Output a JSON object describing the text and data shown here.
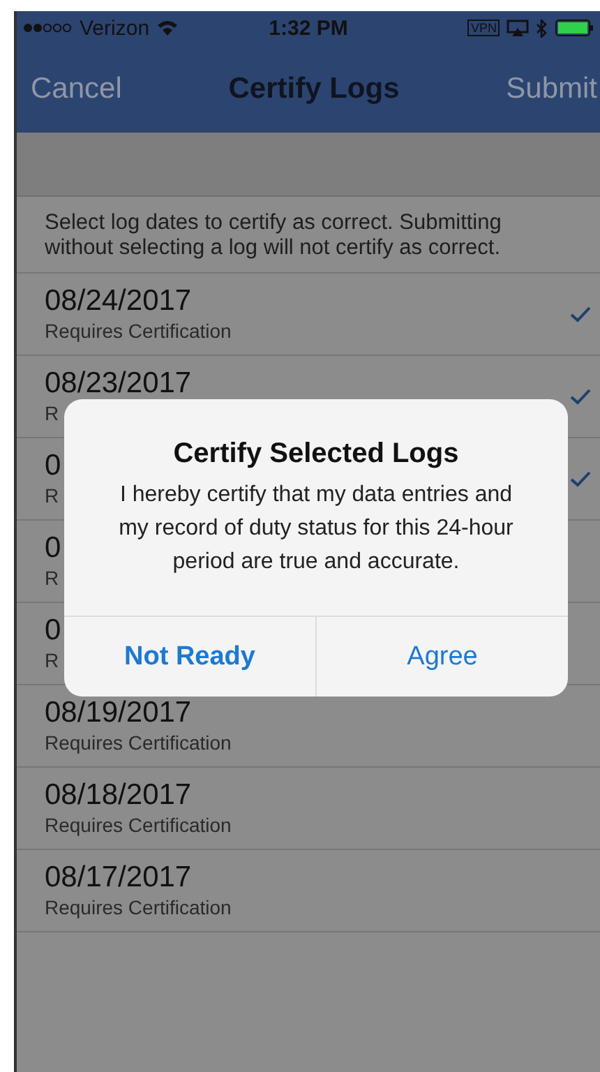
{
  "status_bar": {
    "carrier": "Verizon",
    "time": "1:32 PM",
    "vpn": "VPN"
  },
  "nav_bar": {
    "left": "Cancel",
    "title": "Certify Logs",
    "right": "Submit"
  },
  "instructions": "Select log dates to certify as correct.  Submitting without selecting a log will not certify as correct.",
  "logs": [
    {
      "date": "08/24/2017",
      "status": "Requires Certification",
      "selected": true
    },
    {
      "date": "08/23/2017",
      "status": "R",
      "selected": true
    },
    {
      "date": "0",
      "status": "R",
      "selected": true
    },
    {
      "date": "0",
      "status": "R",
      "selected": false
    },
    {
      "date": "0",
      "status": "R",
      "selected": false
    },
    {
      "date": "08/19/2017",
      "status": "Requires Certification",
      "selected": false
    },
    {
      "date": "08/18/2017",
      "status": "Requires Certification",
      "selected": false
    },
    {
      "date": "08/17/2017",
      "status": "Requires Certification",
      "selected": false
    }
  ],
  "alert": {
    "title": "Certify Selected Logs",
    "message": "I hereby certify that my data entries and my record of duty status for this 24-hour period are true and accurate.",
    "buttons": [
      {
        "label": "Not Ready",
        "kind": "cancel"
      },
      {
        "label": "Agree",
        "kind": "default"
      }
    ]
  }
}
